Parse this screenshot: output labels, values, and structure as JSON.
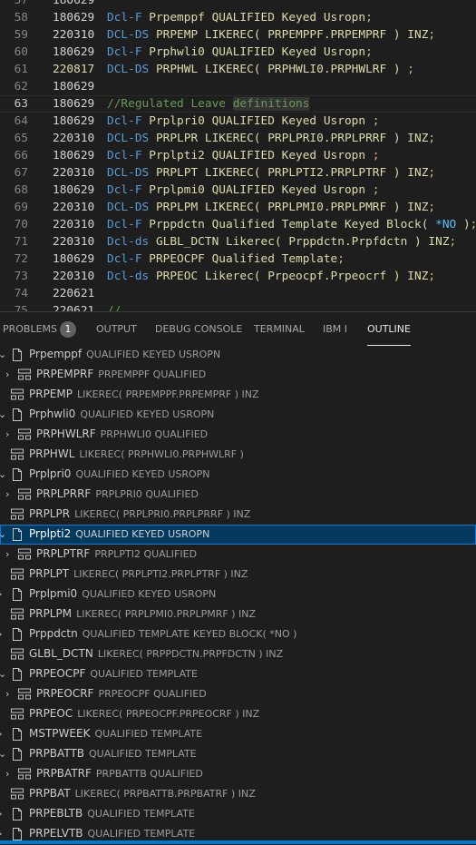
{
  "editor": {
    "partial_top": {
      "line": "57",
      "date": "180629"
    },
    "lines": [
      {
        "num": "58",
        "date": "180629",
        "tokens": [
          {
            "c": "kw",
            "t": "Dcl-F "
          },
          {
            "c": "text",
            "t": "Prpemppf QUALIFIED Keyed Usropn"
          },
          {
            "c": "semi",
            "t": ";"
          }
        ]
      },
      {
        "num": "59",
        "date": "220310",
        "tokens": [
          {
            "c": "kw",
            "t": "DCL-DS "
          },
          {
            "c": "text",
            "t": "PRPEMP LIKEREC( PRPEMPPF.PRPEMPRF ) INZ"
          },
          {
            "c": "semi",
            "t": ";"
          }
        ]
      },
      {
        "num": "60",
        "date": "180629",
        "tokens": [
          {
            "c": "kw",
            "t": "Dcl-F "
          },
          {
            "c": "text",
            "t": "Prphwli0 QUALIFIED Keyed Usropn"
          },
          {
            "c": "semi",
            "t": ";"
          }
        ]
      },
      {
        "num": "61",
        "date": "220817",
        "date_mod": true,
        "tokens": [
          {
            "c": "kw",
            "t": "DCL-DS "
          },
          {
            "c": "text",
            "t": "PRPHWL LIKEREC( PRPHWLI0.PRPHWLRF ) "
          },
          {
            "c": "semi",
            "t": ";"
          }
        ]
      },
      {
        "num": "62",
        "date": "180629",
        "tokens": []
      },
      {
        "num": "63",
        "date": "180629",
        "current": true,
        "tokens": [
          {
            "c": "comment",
            "t": "//Regulated Leave "
          },
          {
            "c": "comment hl",
            "t": "definitions"
          }
        ]
      },
      {
        "num": "64",
        "date": "180629",
        "tokens": [
          {
            "c": "kw",
            "t": "Dcl-F "
          },
          {
            "c": "text",
            "t": "Prplpri0 QUALIFIED Keyed Usropn "
          },
          {
            "c": "semi",
            "t": ";"
          }
        ]
      },
      {
        "num": "65",
        "date": "220310",
        "tokens": [
          {
            "c": "kw",
            "t": "DCL-DS "
          },
          {
            "c": "text",
            "t": "PRPLPR LIKEREC( PRPLPRI0.PRPLPRRF ) INZ"
          },
          {
            "c": "semi",
            "t": ";"
          }
        ]
      },
      {
        "num": "66",
        "date": "180629",
        "tokens": [
          {
            "c": "kw",
            "t": "Dcl-F "
          },
          {
            "c": "text",
            "t": "Prplpti2 QUALIFIED Keyed Usropn "
          },
          {
            "c": "semi",
            "t": ";"
          }
        ]
      },
      {
        "num": "67",
        "date": "220310",
        "tokens": [
          {
            "c": "kw",
            "t": "DCL-DS "
          },
          {
            "c": "text",
            "t": "PRPLPT LIKEREC( PRPLPTI2.PRPLPTRF ) INZ"
          },
          {
            "c": "semi",
            "t": ";"
          }
        ]
      },
      {
        "num": "68",
        "date": "180629",
        "tokens": [
          {
            "c": "kw",
            "t": "Dcl-F "
          },
          {
            "c": "text",
            "t": "Prplpmi0 QUALIFIED Keyed Usropn "
          },
          {
            "c": "semi",
            "t": ";"
          }
        ]
      },
      {
        "num": "69",
        "date": "220310",
        "tokens": [
          {
            "c": "kw",
            "t": "DCL-DS "
          },
          {
            "c": "text",
            "t": "PRPLPM LIKEREC( PRPLPMI0.PRPLPMRF ) INZ"
          },
          {
            "c": "semi",
            "t": ";"
          }
        ]
      },
      {
        "num": "70",
        "date": "220310",
        "tokens": [
          {
            "c": "kw",
            "t": "Dcl-F "
          },
          {
            "c": "text",
            "t": "Prppdctn Qualified Template Keyed Block( "
          },
          {
            "c": "const",
            "t": "*NO"
          },
          {
            "c": "text",
            "t": " )"
          },
          {
            "c": "semi",
            "t": ";"
          }
        ]
      },
      {
        "num": "71",
        "date": "220310",
        "tokens": [
          {
            "c": "kw",
            "t": "Dcl-ds "
          },
          {
            "c": "text",
            "t": "GLBL_DCTN Likerec( Prppdctn.Prpfdctn ) INZ"
          },
          {
            "c": "semi",
            "t": ";"
          }
        ]
      },
      {
        "num": "72",
        "date": "180629",
        "tokens": [
          {
            "c": "kw",
            "t": "Dcl-F "
          },
          {
            "c": "text",
            "t": "PRPEOCPF Qualified Template"
          },
          {
            "c": "semi",
            "t": ";"
          }
        ]
      },
      {
        "num": "73",
        "date": "220310",
        "tokens": [
          {
            "c": "kw",
            "t": "Dcl-ds "
          },
          {
            "c": "text",
            "t": "PRPEOC Likerec( Prpeocpf.Prpeocrf ) INZ"
          },
          {
            "c": "semi",
            "t": ";"
          }
        ]
      },
      {
        "num": "74",
        "date": "220621",
        "tokens": []
      }
    ],
    "partial_bottom": {
      "line": "75",
      "date": "220621",
      "code": "//"
    }
  },
  "panel": {
    "tabs": [
      {
        "label": "PROBLEMS",
        "active": false
      },
      {
        "label": "OUTPUT",
        "active": false
      },
      {
        "label": "DEBUG CONSOLE",
        "active": false
      },
      {
        "label": "TERMINAL",
        "active": false
      },
      {
        "label": "IBM I",
        "active": false
      },
      {
        "label": "OUTLINE",
        "active": true
      }
    ],
    "problems_count": "1"
  },
  "outline": [
    {
      "icon": "file",
      "chev": "down",
      "indent": 0,
      "name": "Prpemppf",
      "desc": "QUALIFIED KEYED USROPN"
    },
    {
      "icon": "struct",
      "chev": "right",
      "indent": 1,
      "name": "PRPEMPRF",
      "desc": "PRPEMPPF QUALIFIED"
    },
    {
      "icon": "struct",
      "chev": "none",
      "indent": 0,
      "name": "PRPEMP",
      "desc": "LIKEREC( PRPEMPPF.PRPEMPRF ) INZ"
    },
    {
      "icon": "file",
      "chev": "down",
      "indent": 0,
      "name": "Prphwli0",
      "desc": "QUALIFIED KEYED USROPN"
    },
    {
      "icon": "struct",
      "chev": "right",
      "indent": 1,
      "name": "PRPHWLRF",
      "desc": "PRPHWLI0 QUALIFIED"
    },
    {
      "icon": "struct",
      "chev": "none",
      "indent": 0,
      "name": "PRPHWL",
      "desc": "LIKEREC( PRPHWLI0.PRPHWLRF )"
    },
    {
      "icon": "file",
      "chev": "down",
      "indent": 0,
      "name": "Prplpri0",
      "desc": "QUALIFIED KEYED USROPN"
    },
    {
      "icon": "struct",
      "chev": "right",
      "indent": 1,
      "name": "PRPLPRRF",
      "desc": "PRPLPRI0 QUALIFIED"
    },
    {
      "icon": "struct",
      "chev": "none",
      "indent": 0,
      "name": "PRPLPR",
      "desc": "LIKEREC( PRPLPRI0.PRPLPRRF ) INZ"
    },
    {
      "icon": "file",
      "chev": "down",
      "indent": 0,
      "name": "Prplpti2",
      "desc": "QUALIFIED KEYED USROPN",
      "selected": true
    },
    {
      "icon": "struct",
      "chev": "right",
      "indent": 1,
      "name": "PRPLPTRF",
      "desc": "PRPLPTI2 QUALIFIED"
    },
    {
      "icon": "struct",
      "chev": "none",
      "indent": 0,
      "name": "PRPLPT",
      "desc": "LIKEREC( PRPLPTI2.PRPLPTRF ) INZ"
    },
    {
      "icon": "file",
      "chev": "right",
      "indent": 0,
      "name": "Prplpmi0",
      "desc": "QUALIFIED KEYED USROPN"
    },
    {
      "icon": "struct",
      "chev": "none",
      "indent": 0,
      "name": "PRPLPM",
      "desc": "LIKEREC( PRPLPMI0.PRPLPMRF ) INZ"
    },
    {
      "icon": "file",
      "chev": "right",
      "indent": 0,
      "name": "Prppdctn",
      "desc": "QUALIFIED TEMPLATE KEYED BLOCK( *NO )"
    },
    {
      "icon": "struct",
      "chev": "none",
      "indent": 0,
      "name": "GLBL_DCTN",
      "desc": "LIKEREC( PRPPDCTN.PRPFDCTN ) INZ"
    },
    {
      "icon": "file",
      "chev": "down",
      "indent": 0,
      "name": "PRPEOCPF",
      "desc": "QUALIFIED TEMPLATE"
    },
    {
      "icon": "struct",
      "chev": "right",
      "indent": 1,
      "name": "PRPEOCRF",
      "desc": "PRPEOCPF QUALIFIED"
    },
    {
      "icon": "struct",
      "chev": "none",
      "indent": 0,
      "name": "PRPEOC",
      "desc": "LIKEREC( PRPEOCPF.PRPEOCRF ) INZ"
    },
    {
      "icon": "file",
      "chev": "right",
      "indent": 0,
      "name": "MSTPWEEK",
      "desc": "QUALIFIED TEMPLATE"
    },
    {
      "icon": "file",
      "chev": "down",
      "indent": 0,
      "name": "PRPBATTB",
      "desc": "QUALIFIED TEMPLATE"
    },
    {
      "icon": "struct",
      "chev": "right",
      "indent": 1,
      "name": "PRPBATRF",
      "desc": "PRPBATTB QUALIFIED"
    },
    {
      "icon": "struct",
      "chev": "none",
      "indent": 0,
      "name": "PRPBAT",
      "desc": "LIKEREC( PRPBATTB.PRPBATRF ) INZ"
    },
    {
      "icon": "file",
      "chev": "right",
      "indent": 0,
      "name": "PRPEBLTB",
      "desc": "QUALIFIED TEMPLATE"
    },
    {
      "icon": "file",
      "chev": "right",
      "indent": 0,
      "name": "PRPELVTB",
      "desc": "QUALIFIED TEMPLATE"
    }
  ],
  "colors": {
    "selection": "#04395e",
    "accent": "#007acc",
    "keyword": "#569cd6",
    "text": "#dcdcaa",
    "comment": "#6a9955"
  }
}
